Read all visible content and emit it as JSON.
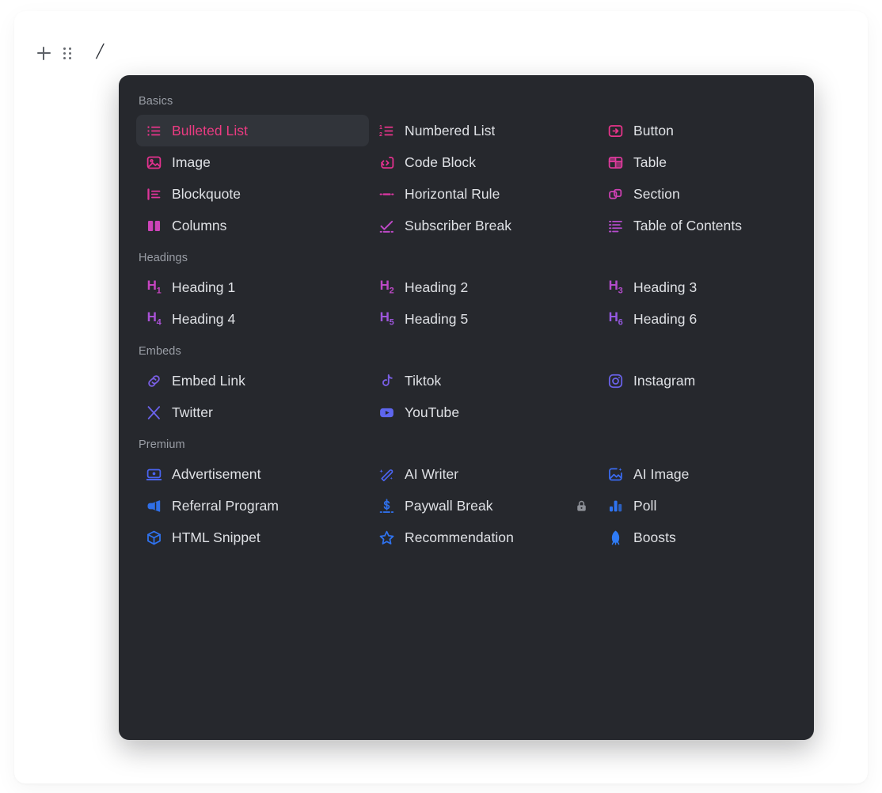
{
  "editor": {
    "add_block_label": "+",
    "drag_handle_label": "drag",
    "slash_char": "/"
  },
  "menu": {
    "selected_command": "Bulleted List",
    "colors": {
      "panel_bg": "#26282d",
      "selected_bg": "#31343a",
      "selected_text": "#ec3b82",
      "label_text": "#dfe1e5",
      "group_label_text": "#9a9ea6",
      "basics_pink": "#e8348a",
      "basics_magenta": "#d23ab0",
      "headings_purple": "#a94fd8",
      "embeds_indigo": "#6b63e8",
      "premium_blue": "#2f6fe8",
      "lock_gray": "#8d9097"
    },
    "groups": [
      {
        "label": "Basics",
        "items": [
          {
            "label": "Bulleted List",
            "icon": "bulleted-list-icon",
            "color": "#e8348a",
            "selected": true,
            "locked": false
          },
          {
            "label": "Numbered List",
            "icon": "numbered-list-icon",
            "color": "#e8348a",
            "selected": false,
            "locked": false
          },
          {
            "label": "Button",
            "icon": "button-icon",
            "color": "#e8348a",
            "selected": false,
            "locked": false
          },
          {
            "label": "Image",
            "icon": "image-icon",
            "color": "#e5318f",
            "selected": false,
            "locked": false
          },
          {
            "label": "Code Block",
            "icon": "code-block-icon",
            "color": "#e5318f",
            "selected": false,
            "locked": false
          },
          {
            "label": "Table",
            "icon": "table-icon",
            "color": "#de3a9c",
            "selected": false,
            "locked": false
          },
          {
            "label": "Blockquote",
            "icon": "blockquote-icon",
            "color": "#e0359b",
            "selected": false,
            "locked": false
          },
          {
            "label": "Horizontal Rule",
            "icon": "horizontal-rule-icon",
            "color": "#dc37a3",
            "selected": false,
            "locked": false
          },
          {
            "label": "Section",
            "icon": "section-icon",
            "color": "#cf41b4",
            "selected": false,
            "locked": false
          },
          {
            "label": "Columns",
            "icon": "columns-icon",
            "color": "#cc43b8",
            "selected": false,
            "locked": false
          },
          {
            "label": "Subscriber Break",
            "icon": "subscriber-break-icon",
            "color": "#bd49c6",
            "selected": false,
            "locked": false
          },
          {
            "label": "Table of Contents",
            "icon": "table-of-contents-icon",
            "color": "#b64ccd",
            "selected": false,
            "locked": false
          }
        ]
      },
      {
        "label": "Headings",
        "items": [
          {
            "label": "Heading 1",
            "icon": "heading-1-icon",
            "htag": "H",
            "hsub": "1",
            "color": "#c644c0",
            "selected": false,
            "locked": false
          },
          {
            "label": "Heading 2",
            "icon": "heading-2-icon",
            "htag": "H",
            "hsub": "2",
            "color": "#bd49c6",
            "selected": false,
            "locked": false
          },
          {
            "label": "Heading 3",
            "icon": "heading-3-icon",
            "htag": "H",
            "hsub": "3",
            "color": "#b44ccc",
            "selected": false,
            "locked": false
          },
          {
            "label": "Heading 4",
            "icon": "heading-4-icon",
            "htag": "H",
            "hsub": "4",
            "color": "#a951d5",
            "selected": false,
            "locked": false
          },
          {
            "label": "Heading 5",
            "icon": "heading-5-icon",
            "htag": "H",
            "hsub": "5",
            "color": "#9e56dc",
            "selected": false,
            "locked": false
          },
          {
            "label": "Heading 6",
            "icon": "heading-6-icon",
            "htag": "H",
            "hsub": "6",
            "color": "#9559e2",
            "selected": false,
            "locked": false
          }
        ]
      },
      {
        "label": "Embeds",
        "items": [
          {
            "label": "Embed Link",
            "icon": "link-icon",
            "color": "#7a5fe6",
            "selected": false,
            "locked": false
          },
          {
            "label": "Tiktok",
            "icon": "tiktok-icon",
            "color": "#7a5fe6",
            "selected": false,
            "locked": false
          },
          {
            "label": "Instagram",
            "icon": "instagram-icon",
            "color": "#6a62ea",
            "selected": false,
            "locked": false
          },
          {
            "label": "Twitter",
            "icon": "twitter-x-icon",
            "color": "#6a62ea",
            "selected": false,
            "locked": false
          },
          {
            "label": "YouTube",
            "icon": "youtube-icon",
            "color": "#5e66ee",
            "selected": false,
            "locked": false
          }
        ]
      },
      {
        "label": "Premium",
        "items": [
          {
            "label": "Advertisement",
            "icon": "advertisement-icon",
            "color": "#4a64f0",
            "selected": false,
            "locked": false
          },
          {
            "label": "AI Writer",
            "icon": "ai-writer-icon",
            "color": "#4a64f0",
            "selected": false,
            "locked": false
          },
          {
            "label": "AI Image",
            "icon": "ai-image-icon",
            "color": "#3a6bf2",
            "selected": false,
            "locked": false
          },
          {
            "label": "Referral Program",
            "icon": "referral-program-icon",
            "color": "#2f6fe8",
            "selected": false,
            "locked": false
          },
          {
            "label": "Paywall Break",
            "icon": "paywall-break-icon",
            "color": "#2f6fe8",
            "selected": false,
            "locked": true
          },
          {
            "label": "Poll",
            "icon": "poll-icon",
            "color": "#2f73f0",
            "selected": false,
            "locked": false
          },
          {
            "label": "HTML Snippet",
            "icon": "html-snippet-icon",
            "color": "#2f73f0",
            "selected": false,
            "locked": false
          },
          {
            "label": "Recommendation",
            "icon": "recommendation-icon",
            "color": "#2f73f0",
            "selected": false,
            "locked": false
          },
          {
            "label": "Boosts",
            "icon": "boosts-icon",
            "color": "#2f7bf5",
            "selected": false,
            "locked": false
          }
        ]
      }
    ]
  }
}
